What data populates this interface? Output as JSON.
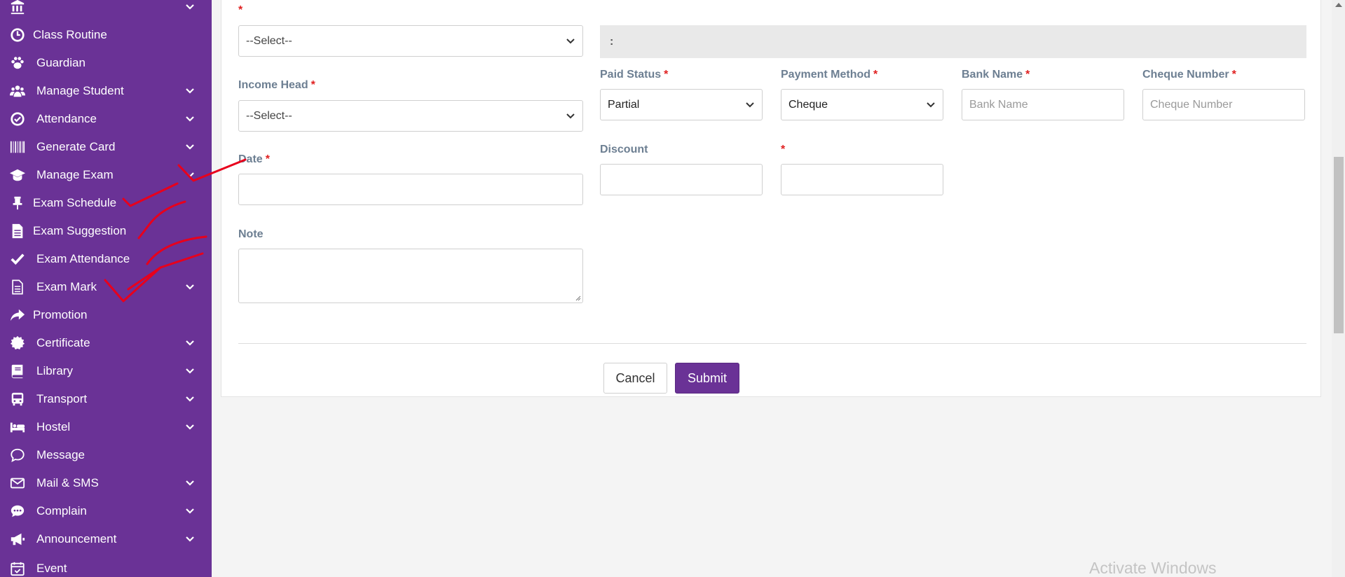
{
  "sidebar": {
    "items": [
      {
        "label": "",
        "icon": "university-icon",
        "chevron": true
      },
      {
        "label": "Class Routine",
        "icon": "clock-icon",
        "chevron": false
      },
      {
        "label": "Guardian",
        "icon": "paw-icon",
        "chevron": false
      },
      {
        "label": "Manage Student",
        "icon": "users-icon",
        "chevron": true
      },
      {
        "label": "Attendance",
        "icon": "check-circle-icon",
        "chevron": true
      },
      {
        "label": "Generate Card",
        "icon": "barcode-icon",
        "chevron": true
      },
      {
        "label": "Manage Exam",
        "icon": "graduation-cap-icon",
        "chevron": true
      },
      {
        "label": "Exam Schedule",
        "icon": "thumbtack-icon",
        "chevron": false
      },
      {
        "label": "Exam Suggestion",
        "icon": "file-text-icon",
        "chevron": false
      },
      {
        "label": "Exam Attendance",
        "icon": "check-icon",
        "chevron": false
      },
      {
        "label": "Exam Mark",
        "icon": "file-alt-icon",
        "chevron": true
      },
      {
        "label": "Promotion",
        "icon": "share-icon",
        "chevron": false
      },
      {
        "label": "Certificate",
        "icon": "certificate-icon",
        "chevron": true
      },
      {
        "label": "Library",
        "icon": "book-icon",
        "chevron": true
      },
      {
        "label": "Transport",
        "icon": "bus-icon",
        "chevron": true
      },
      {
        "label": "Hostel",
        "icon": "bed-icon",
        "chevron": true
      },
      {
        "label": "Message",
        "icon": "comments-icon",
        "chevron": false
      },
      {
        "label": "Mail & SMS",
        "icon": "envelope-icon",
        "chevron": true
      },
      {
        "label": "Complain",
        "icon": "comment-dots-icon",
        "chevron": true
      },
      {
        "label": "Announcement",
        "icon": "bullhorn-icon",
        "chevron": true
      },
      {
        "label": "Event",
        "icon": "calendar-check-icon",
        "chevron": false
      }
    ]
  },
  "form": {
    "required_mark": "*",
    "top_select": "--Select--",
    "info_bar": ":",
    "income_head": {
      "label": "Income Head",
      "value": "--Select--"
    },
    "date": {
      "label": "Date"
    },
    "note": {
      "label": "Note"
    },
    "paid_status": {
      "label": "Paid Status",
      "value": "Partial"
    },
    "payment_method": {
      "label": "Payment Method",
      "value": "Cheque"
    },
    "bank_name": {
      "label": "Bank Name",
      "placeholder": "Bank Name"
    },
    "cheque_number": {
      "label": "Cheque Number",
      "placeholder": "Cheque Number"
    },
    "discount": {
      "label": "Discount"
    },
    "cancel": "Cancel",
    "submit": "Submit"
  },
  "watermark": "Activate Windows",
  "colors": {
    "sidebar": "#6a3296",
    "submit": "#6a3296",
    "required": "#e02020",
    "label": "#6d7f92",
    "annotation": "#e8001c"
  }
}
